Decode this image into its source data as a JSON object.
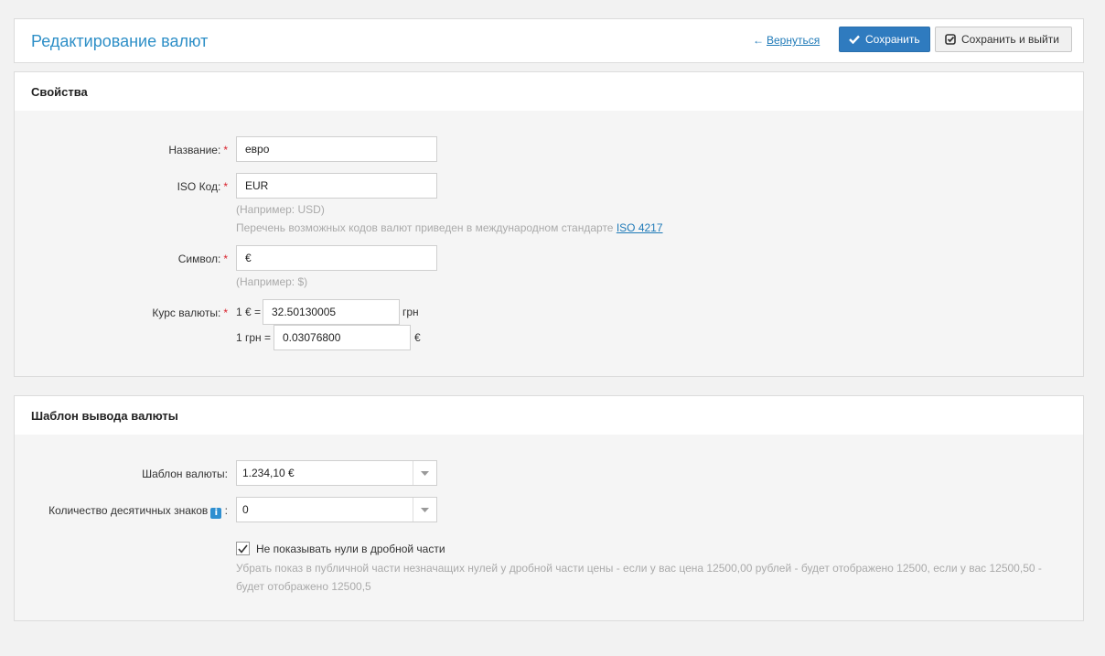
{
  "header": {
    "title": "Редактирование валют",
    "back_label": "Вернуться",
    "save_label": "Сохранить",
    "save_exit_label": "Сохранить и выйти"
  },
  "properties": {
    "title": "Свойства",
    "name": {
      "label": "Название:",
      "value": "евро"
    },
    "iso": {
      "label": "ISO Код:",
      "value": "EUR",
      "example": "(Например: USD)",
      "note": "Перечень возможных кодов валют приведен в международном стандарте",
      "link": "ISO 4217"
    },
    "symbol": {
      "label": "Символ:",
      "value": "€",
      "example": "(Например: $)"
    },
    "rate": {
      "label": "Курс валюты:",
      "row1_prefix": "1 € =",
      "row1_value": "32.50130005",
      "row1_suffix": "грн",
      "row2_prefix": "1 грн =",
      "row2_value": "0.03076800",
      "row2_suffix": "€"
    }
  },
  "template": {
    "title": "Шаблон вывода валюты",
    "currency_template": {
      "label": "Шаблон валюты:",
      "value": "1.234,10 €"
    },
    "decimals": {
      "label": "Количество десятичных знаков",
      "colon": ":",
      "value": "0"
    },
    "hide_zeros": {
      "label": "Не показывать нули в дробной части",
      "checked": true,
      "hint": "Убрать показ в публичной части незначащих нулей у дробной части цены - если у вас цена 12500,00 рублей - будет отображено 12500, если у вас 12500,50 - будет отображено 12500,5"
    }
  },
  "colors": {
    "accent": "#2f7bbf",
    "title": "#2e8fc7",
    "required": "#d9232e"
  }
}
